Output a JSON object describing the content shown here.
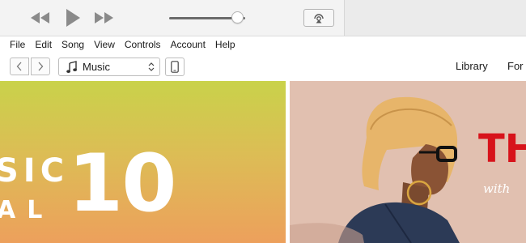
{
  "menu": {
    "items": [
      "File",
      "Edit",
      "Song",
      "View",
      "Controls",
      "Account",
      "Help"
    ]
  },
  "navbar": {
    "media_selector": "Music",
    "links": [
      "Library",
      "For"
    ]
  },
  "playback": {
    "volume": 0.9
  },
  "content": {
    "left_banner": {
      "text_line1": "SIC",
      "text_line2": "AL",
      "big_number": "10"
    },
    "right_banner": {
      "title": "TH",
      "subtitle": "with"
    }
  },
  "colors": {
    "left_banner_top": "#c9d24a",
    "left_banner_bottom": "#eda05c",
    "right_banner_bg": "#e1c0b0",
    "right_banner_title": "#d7131b"
  },
  "icons": [
    "rewind-icon",
    "play-icon",
    "fast-forward-icon",
    "airplay-icon",
    "chevron-left-icon",
    "chevron-right-icon",
    "music-note-icon",
    "updown-chevron-icon",
    "iphone-icon"
  ]
}
